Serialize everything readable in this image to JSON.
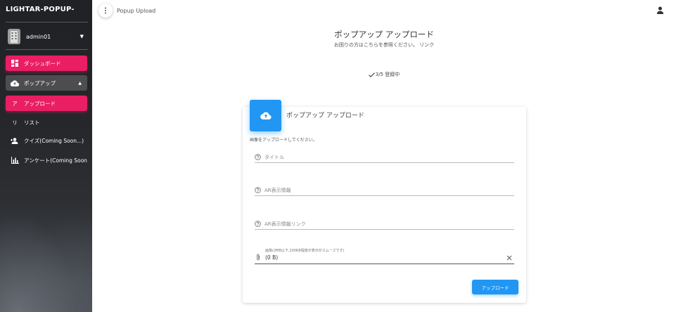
{
  "sidebar": {
    "brand": "LIGHTAR-POPUP-",
    "user": {
      "name": "admin01",
      "avatar_icon": "building-avatar-icon"
    },
    "items": [
      {
        "label": "ダッシュボード",
        "icon": "dashboard-icon",
        "state": "active"
      },
      {
        "label": "ポップアップ",
        "icon": "cloud-upload-icon",
        "state": "open"
      },
      {
        "label": "アップロード",
        "letter": "ア",
        "state": "active"
      },
      {
        "label": "リスト",
        "letter": "リ",
        "state": "normal"
      },
      {
        "label": "クイズ(Coming Soon...)",
        "icon": "person-add-icon",
        "state": "normal"
      },
      {
        "label": "アンケート(Coming Soon...)",
        "icon": "bar-chart-icon",
        "state": "normal"
      }
    ]
  },
  "topbar": {
    "title": "Popup Upload"
  },
  "page": {
    "title": "ポップアップ アップロード",
    "subtitle": "お困りの方はこちらを参照ください。 リンク",
    "status": "3/5 登録中"
  },
  "card": {
    "title": "ポップアップ アップロード",
    "note": "画像をアップロードしてください。",
    "fields": [
      {
        "placeholder": "タイトル"
      },
      {
        "placeholder": "AR表示情報"
      },
      {
        "placeholder": "AR表示情報リンク"
      }
    ],
    "file": {
      "label": "画像(2MB以下,200KB程度が表示がスムーズです)",
      "value": "(0 B)"
    },
    "button": "アップロード"
  },
  "colors": {
    "accent": "#e91e63",
    "primary": "#2196f3",
    "sidebar_bg": "#202124"
  }
}
